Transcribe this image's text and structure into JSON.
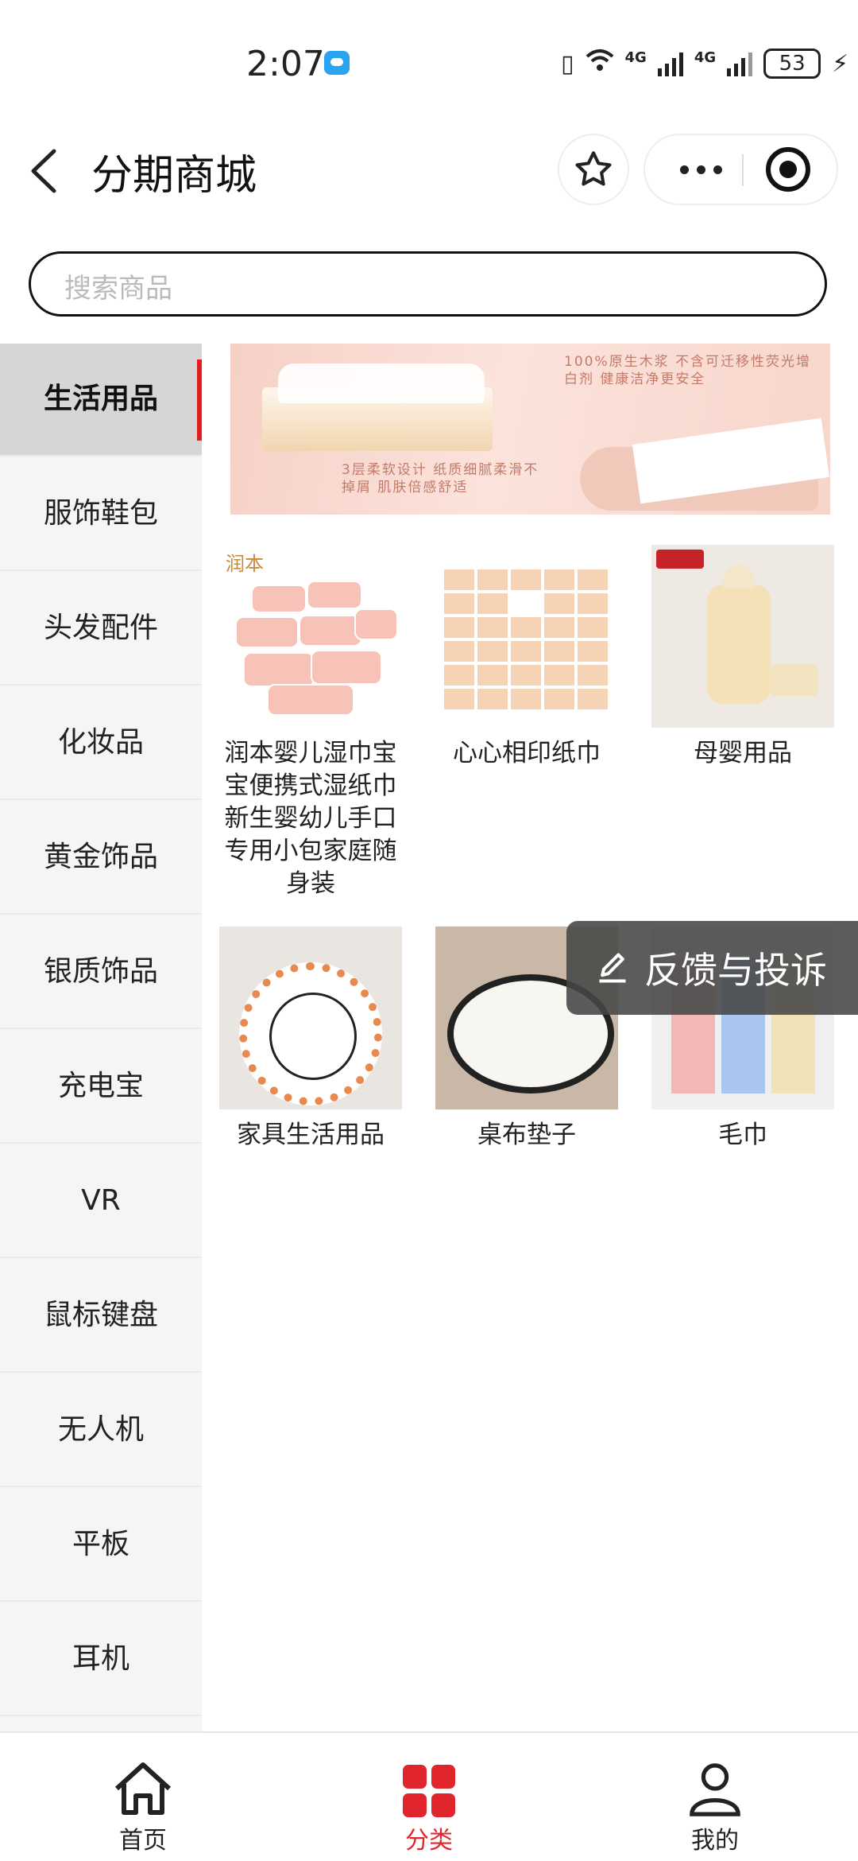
{
  "status_bar": {
    "time": "2:07",
    "network_1": "4G",
    "network_2": "4G",
    "battery": "53",
    "icons": [
      "chat-notification-icon",
      "vibrate-icon",
      "wifi-icon",
      "signal-icon",
      "battery-icon",
      "charging-icon"
    ]
  },
  "header": {
    "title": "分期商城",
    "icons": [
      "back-icon",
      "star-icon",
      "more-icon",
      "close-target-icon"
    ]
  },
  "search": {
    "placeholder": "搜索商品"
  },
  "sidebar": {
    "active_color": "#e02020",
    "items": [
      {
        "label": "生活用品",
        "active": true
      },
      {
        "label": "服饰鞋包",
        "active": false
      },
      {
        "label": "头发配件",
        "active": false
      },
      {
        "label": "化妆品",
        "active": false
      },
      {
        "label": "黄金饰品",
        "active": false
      },
      {
        "label": "银质饰品",
        "active": false
      },
      {
        "label": "充电宝",
        "active": false
      },
      {
        "label": "VR",
        "active": false
      },
      {
        "label": "鼠标键盘",
        "active": false
      },
      {
        "label": "无人机",
        "active": false
      },
      {
        "label": "平板",
        "active": false
      },
      {
        "label": "耳机",
        "active": false
      }
    ]
  },
  "banner": {
    "text_1": "100%原生木浆 不含可迁移性荧光增白剂 健康洁净更安全",
    "text_2": "3层柔软设计 纸质细腻柔滑不掉屑 肌肤倍感舒适"
  },
  "products": [
    {
      "name": "润本婴儿湿巾宝宝便携式湿纸巾新生婴幼儿手口专用小包家庭随身装",
      "brand_text": "润本"
    },
    {
      "name": "心心相印纸巾"
    },
    {
      "name": "母婴用品"
    },
    {
      "name": "家具生活用品"
    },
    {
      "name": "桌布垫子"
    },
    {
      "name": "毛巾"
    }
  ],
  "feedback": {
    "label": "反馈与投诉",
    "icon": "edit-icon"
  },
  "tabbar": {
    "accent": "#e0262c",
    "items": [
      {
        "label": "首页",
        "icon": "home-icon",
        "active": false
      },
      {
        "label": "分类",
        "icon": "category-grid-icon",
        "active": true
      },
      {
        "label": "我的",
        "icon": "user-icon",
        "active": false
      }
    ]
  }
}
